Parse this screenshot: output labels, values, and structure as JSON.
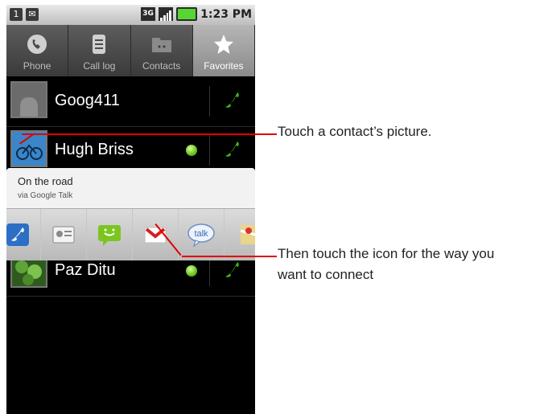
{
  "status_bar": {
    "left_icons": [
      "notification-1-icon",
      "gmail-notification-icon"
    ],
    "network": "3G",
    "time": "1:23 PM",
    "colors": {
      "battery": "#55d633"
    }
  },
  "tabs": [
    {
      "label": "Phone",
      "icon": "phone-icon",
      "active": false
    },
    {
      "label": "Call log",
      "icon": "call-log-icon",
      "active": false
    },
    {
      "label": "Contacts",
      "icon": "contacts-icon",
      "active": false
    },
    {
      "label": "Favorites",
      "icon": "star-icon",
      "active": true
    }
  ],
  "favorites": [
    {
      "name": "Goog411",
      "online": false
    },
    {
      "name": "Hugh Briss",
      "online": true
    },
    {
      "name": "Paz Ditu",
      "online": true
    }
  ],
  "quick_contact": {
    "status": "On the road",
    "via": "via Google Talk",
    "actions": [
      "phone-icon",
      "contact-card-icon",
      "sms-icon",
      "gmail-icon",
      "talk-icon",
      "maps-icon"
    ],
    "talk_label": "talk"
  },
  "callouts": {
    "picture": "Touch a contact’s picture.",
    "icon_line1": "Then touch the icon for the way you",
    "icon_line2": "want to connect"
  },
  "colors": {
    "callout_line": "#e00000",
    "call_green": "#3fb51a",
    "presence_green": "#67c21b"
  }
}
